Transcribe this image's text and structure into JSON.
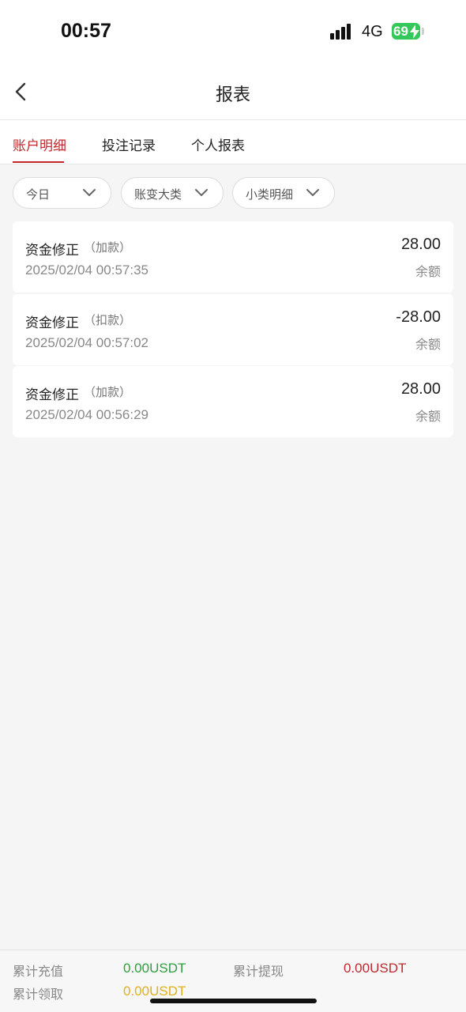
{
  "status": {
    "time": "00:57",
    "network": "4G",
    "battery": "69"
  },
  "nav": {
    "title": "报表"
  },
  "tabs": [
    {
      "label": "账户明细",
      "active": true
    },
    {
      "label": "投注记录",
      "active": false
    },
    {
      "label": "个人报表",
      "active": false
    }
  ],
  "filters": [
    {
      "label": "今日"
    },
    {
      "label": "账变大类"
    },
    {
      "label": "小类明细"
    }
  ],
  "records": [
    {
      "title": "资金修正",
      "tag": "（加款）",
      "time": "2025/02/04 00:57:35",
      "amount": "28.00",
      "balance_label": "余额"
    },
    {
      "title": "资金修正",
      "tag": "（扣款）",
      "time": "2025/02/04 00:57:02",
      "amount": "-28.00",
      "balance_label": "余额"
    },
    {
      "title": "资金修正",
      "tag": "（加款）",
      "time": "2025/02/04 00:56:29",
      "amount": "28.00",
      "balance_label": "余额"
    }
  ],
  "summary": {
    "deposit_label": "累计充值",
    "deposit_value": "0.00USDT",
    "withdraw_label": "累计提现",
    "withdraw_value": "0.00USDT",
    "claim_label": "累计领取",
    "claim_value": "0.00USDT"
  },
  "colors": {
    "accent": "#c0282d",
    "deposit": "#2e9e3e",
    "withdraw": "#c0282d",
    "claim": "#e0b020",
    "battery": "#34c759"
  }
}
